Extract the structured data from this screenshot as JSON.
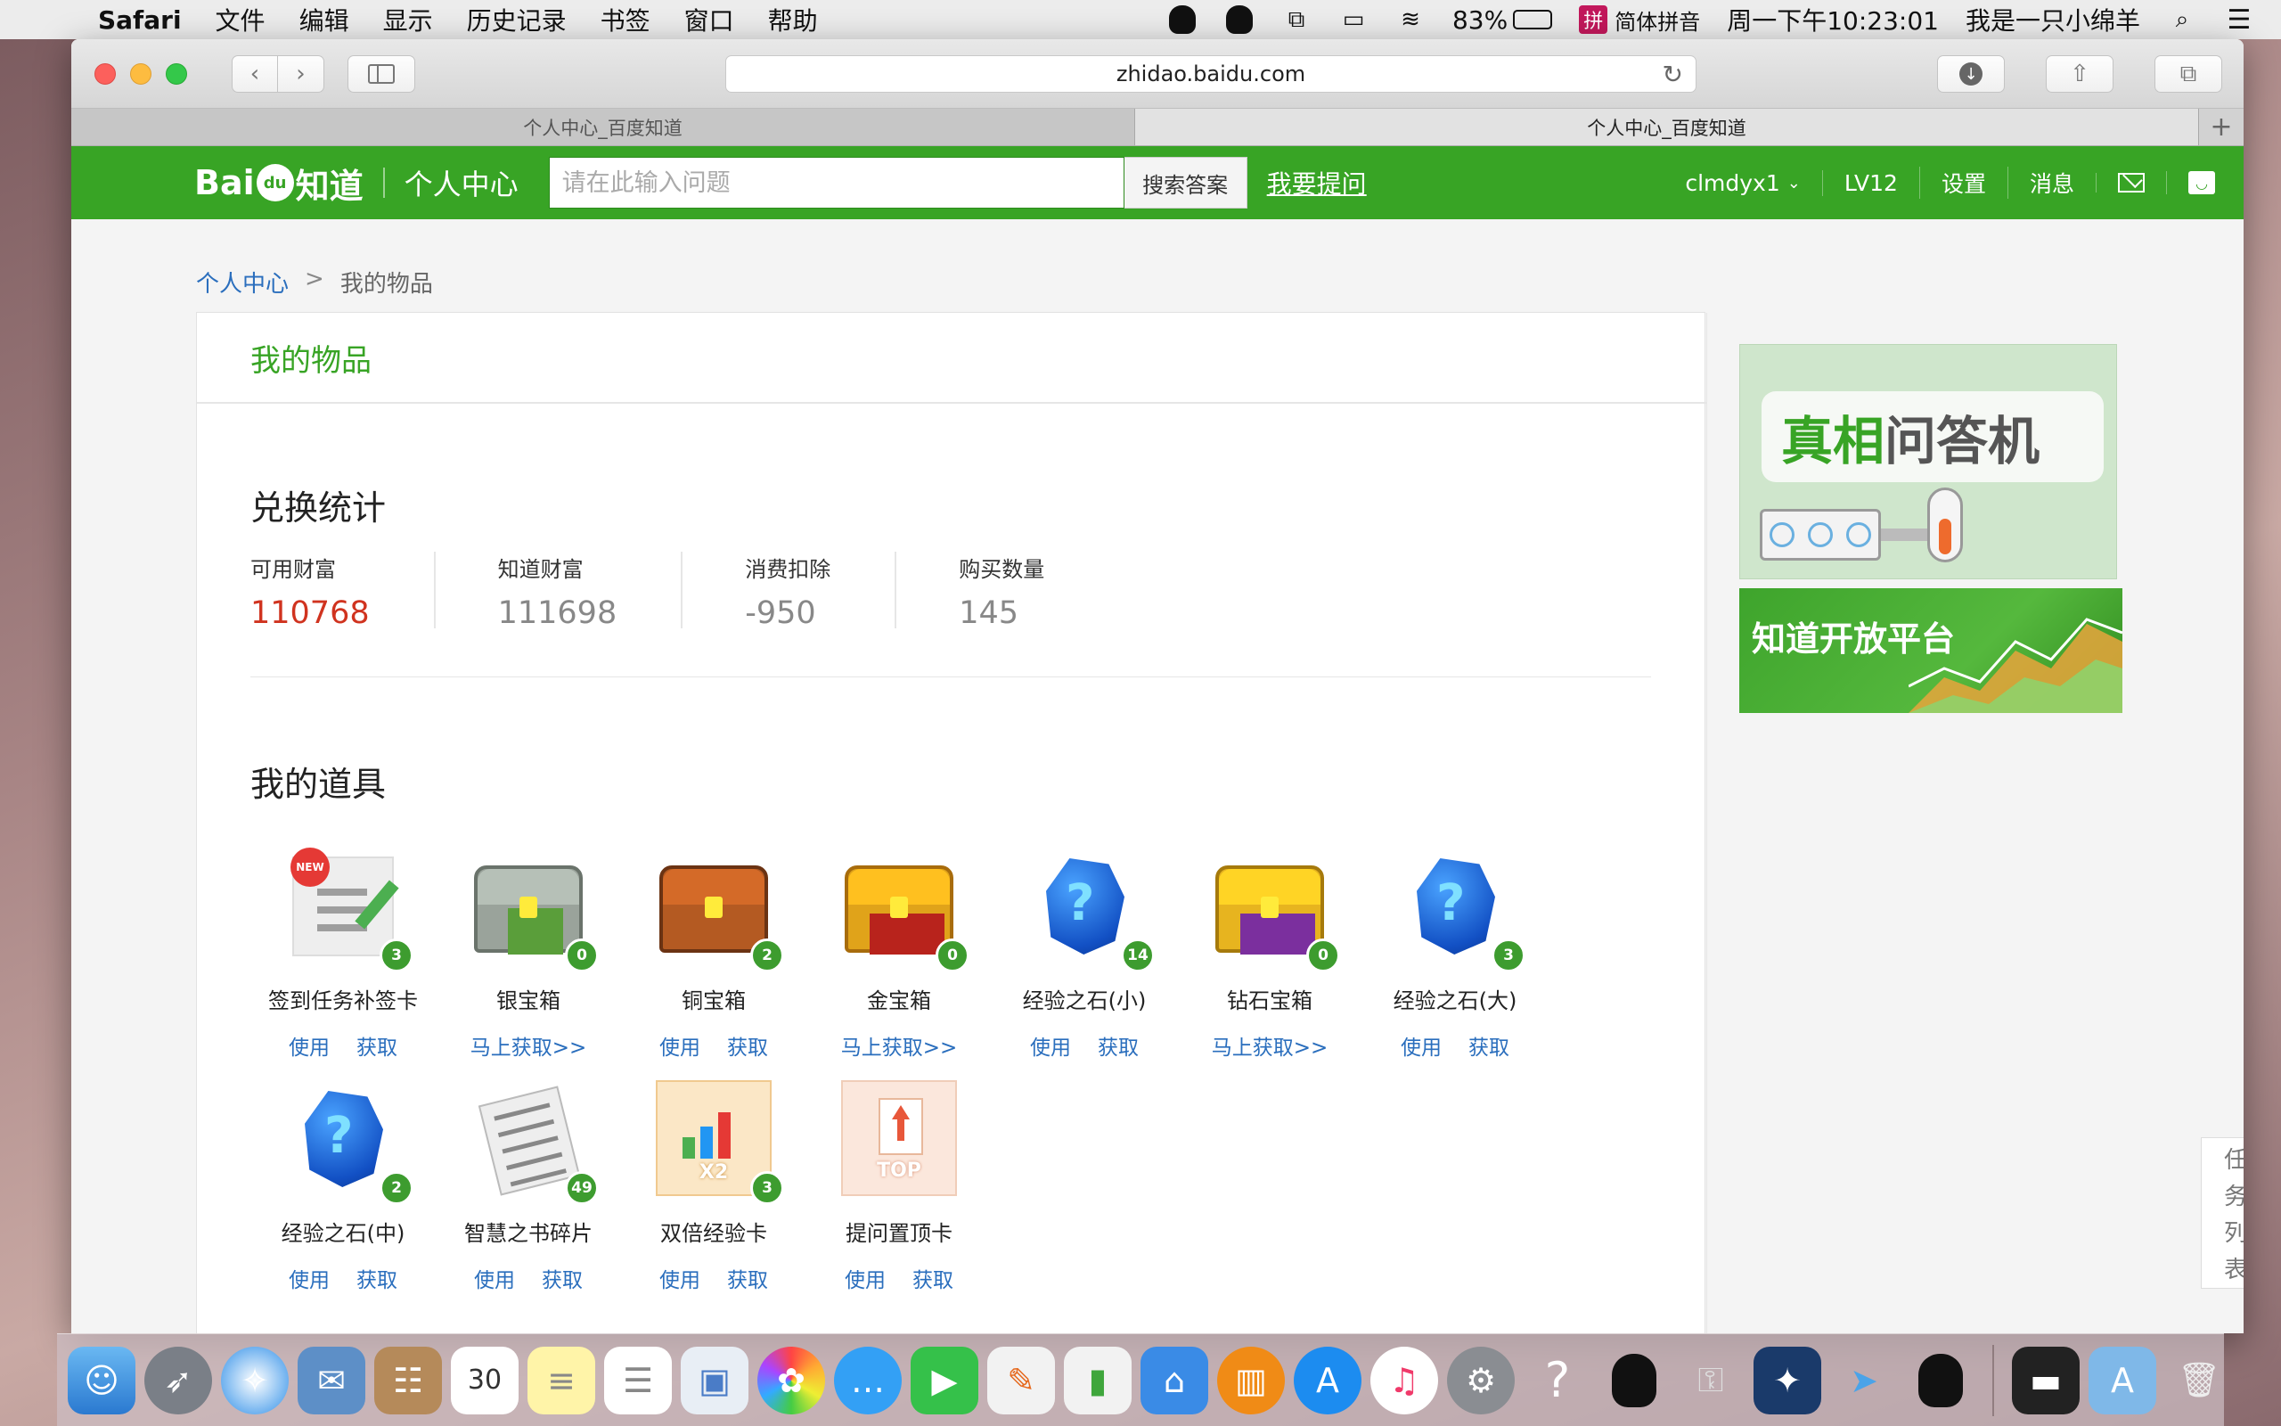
{
  "menubar": {
    "app_name": "Safari",
    "items": [
      "文件",
      "编辑",
      "显示",
      "历史记录",
      "书签",
      "窗口",
      "帮助"
    ],
    "battery_percent": "83%",
    "battery_level": 0.83,
    "ime_label": "简体拼音",
    "ime_badge": "拼",
    "clock": "周一下午10:23:01",
    "user_name": "我是一只小绵羊"
  },
  "browser": {
    "url": "zhidao.baidu.com",
    "tabs": [
      {
        "title": "个人中心_百度知道",
        "active": false
      },
      {
        "title": "个人中心_百度知道",
        "active": true
      }
    ]
  },
  "header": {
    "logo_text_1": "Bai",
    "logo_text_2": "du",
    "logo_text_3": "知道",
    "section_title": "个人中心",
    "search_placeholder": "请在此输入问题",
    "search_button": "搜索答案",
    "ask_link": "我要提问",
    "username": "clmdyx1",
    "level": "LV12",
    "settings": "设置",
    "messages": "消息"
  },
  "breadcrumb": {
    "root": "个人中心",
    "separator": ">",
    "current": "我的物品"
  },
  "card": {
    "title": "我的物品"
  },
  "exchange": {
    "title": "兑换统计",
    "stats": [
      {
        "label": "可用财富",
        "value": "110768"
      },
      {
        "label": "知道财富",
        "value": "111698"
      },
      {
        "label": "消费扣除",
        "value": "-950"
      },
      {
        "label": "购买数量",
        "value": "145"
      }
    ]
  },
  "props": {
    "title": "我的道具",
    "use_label": "使用",
    "get_label": "获取",
    "get_now_label": "马上获取>>",
    "items": [
      {
        "name": "签到任务补签卡",
        "count": "3",
        "art": "sign-card-icon"
      },
      {
        "name": "银宝箱",
        "count": "0",
        "art": "silver-chest-icon"
      },
      {
        "name": "铜宝箱",
        "count": "2",
        "art": "copper-chest-icon"
      },
      {
        "name": "金宝箱",
        "count": "0",
        "art": "gold-chest-icon"
      },
      {
        "name": "经验之石(小)",
        "count": "14",
        "art": "exp-stone-icon"
      },
      {
        "name": "钻石宝箱",
        "count": "0",
        "art": "diamond-chest-icon"
      },
      {
        "name": "经验之石(大)",
        "count": "3",
        "art": "exp-stone-icon"
      },
      {
        "name": "经验之石(中)",
        "count": "2",
        "art": "exp-stone-icon"
      },
      {
        "name": "智慧之书碎片",
        "count": "49",
        "art": "book-fragment-icon"
      },
      {
        "name": "双倍经验卡",
        "count": "3",
        "art": "double-exp-card-icon"
      },
      {
        "name": "提问置顶卡",
        "count": "",
        "art": "pin-question-card-icon"
      }
    ],
    "new_badge": "NEW",
    "x2_label": "X2",
    "top_label": "TOP"
  },
  "sidebar": {
    "banner1_title_green": "真相",
    "banner1_title_rest": "问答机",
    "banner2_title": "知道开放平台"
  },
  "task_tab": [
    "任",
    "务",
    "列",
    "表"
  ],
  "colors": {
    "baidu_green": "#38a425",
    "link_blue": "#2a6ebd",
    "wealth_red": "#d0331f"
  }
}
